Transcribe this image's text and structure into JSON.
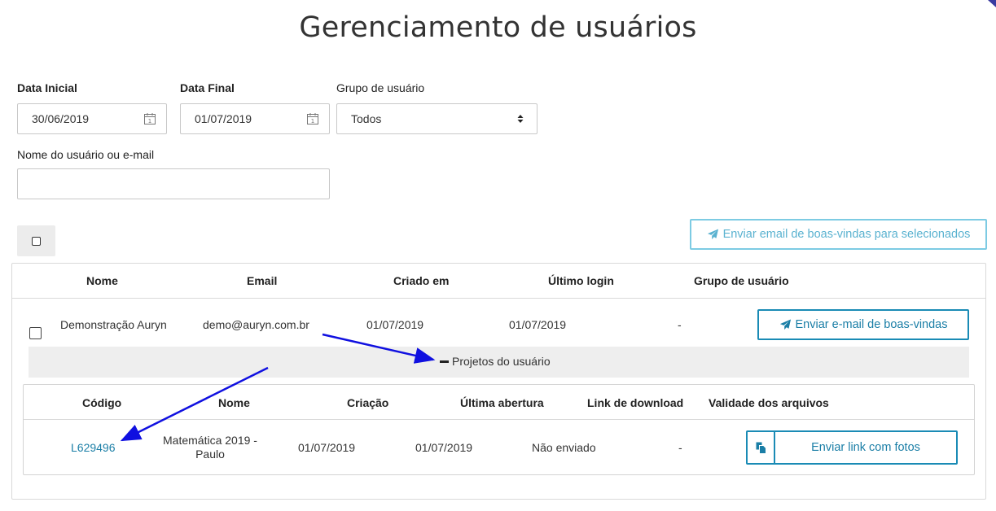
{
  "page": {
    "title": "Gerenciamento de usuários"
  },
  "filters": {
    "start_date": {
      "label": "Data Inicial",
      "value": "30/06/2019"
    },
    "end_date": {
      "label": "Data Final",
      "value": "01/07/2019"
    },
    "user_group": {
      "label": "Grupo de usuário",
      "value": "Todos"
    },
    "search": {
      "label": "Nome do usuário ou e-mail",
      "value": "",
      "placeholder": ""
    }
  },
  "toolbar": {
    "bulk_send_label": "Enviar email de boas-vindas para selecionados"
  },
  "users_table": {
    "headers": [
      "Nome",
      "Email",
      "Criado em",
      "Último login",
      "Grupo de usuário"
    ],
    "rows": [
      {
        "name": "Demonstração Auryn",
        "email": "demo@auryn.com.br",
        "created": "01/07/2019",
        "last_login": "01/07/2019",
        "group": "-",
        "action_label": "Enviar e-mail de boas-vindas"
      }
    ]
  },
  "projects": {
    "toggle_symbol": "−",
    "toggle_label": "Projetos do usuário",
    "headers": [
      "Código",
      "Nome",
      "Criação",
      "Última abertura",
      "Link de download",
      "Validade dos arquivos"
    ],
    "rows": [
      {
        "code": "L629496",
        "name_line1": "Matemática 2019 -",
        "name_line2": "Paulo",
        "created": "01/07/2019",
        "last_opened": "01/07/2019",
        "download_link": "Não enviado",
        "validity": "-",
        "action_label": "Enviar link com fotos"
      }
    ]
  },
  "colors": {
    "accent": "#1a8bb5",
    "annotation_arrow": "#1010e0"
  },
  "icons": [
    "calendar-icon",
    "select-arrows-icon",
    "paper-plane-icon",
    "copy-icon"
  ]
}
